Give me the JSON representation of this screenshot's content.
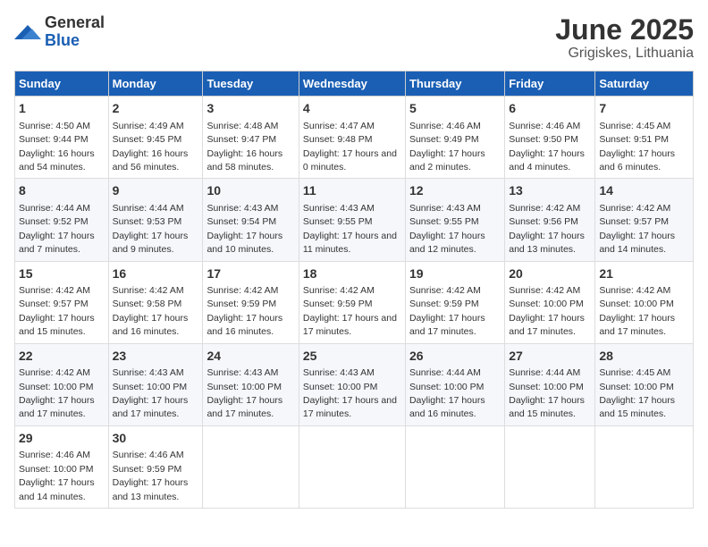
{
  "logo": {
    "general": "General",
    "blue": "Blue"
  },
  "title": "June 2025",
  "subtitle": "Grigiskes, Lithuania",
  "headers": [
    "Sunday",
    "Monday",
    "Tuesday",
    "Wednesday",
    "Thursday",
    "Friday",
    "Saturday"
  ],
  "weeks": [
    [
      {
        "day": "1",
        "sunrise": "4:50 AM",
        "sunset": "9:44 PM",
        "daylight": "16 hours and 54 minutes."
      },
      {
        "day": "2",
        "sunrise": "4:49 AM",
        "sunset": "9:45 PM",
        "daylight": "16 hours and 56 minutes."
      },
      {
        "day": "3",
        "sunrise": "4:48 AM",
        "sunset": "9:47 PM",
        "daylight": "16 hours and 58 minutes."
      },
      {
        "day": "4",
        "sunrise": "4:47 AM",
        "sunset": "9:48 PM",
        "daylight": "17 hours and 0 minutes."
      },
      {
        "day": "5",
        "sunrise": "4:46 AM",
        "sunset": "9:49 PM",
        "daylight": "17 hours and 2 minutes."
      },
      {
        "day": "6",
        "sunrise": "4:46 AM",
        "sunset": "9:50 PM",
        "daylight": "17 hours and 4 minutes."
      },
      {
        "day": "7",
        "sunrise": "4:45 AM",
        "sunset": "9:51 PM",
        "daylight": "17 hours and 6 minutes."
      }
    ],
    [
      {
        "day": "8",
        "sunrise": "4:44 AM",
        "sunset": "9:52 PM",
        "daylight": "17 hours and 7 minutes."
      },
      {
        "day": "9",
        "sunrise": "4:44 AM",
        "sunset": "9:53 PM",
        "daylight": "17 hours and 9 minutes."
      },
      {
        "day": "10",
        "sunrise": "4:43 AM",
        "sunset": "9:54 PM",
        "daylight": "17 hours and 10 minutes."
      },
      {
        "day": "11",
        "sunrise": "4:43 AM",
        "sunset": "9:55 PM",
        "daylight": "17 hours and 11 minutes."
      },
      {
        "day": "12",
        "sunrise": "4:43 AM",
        "sunset": "9:55 PM",
        "daylight": "17 hours and 12 minutes."
      },
      {
        "day": "13",
        "sunrise": "4:42 AM",
        "sunset": "9:56 PM",
        "daylight": "17 hours and 13 minutes."
      },
      {
        "day": "14",
        "sunrise": "4:42 AM",
        "sunset": "9:57 PM",
        "daylight": "17 hours and 14 minutes."
      }
    ],
    [
      {
        "day": "15",
        "sunrise": "4:42 AM",
        "sunset": "9:57 PM",
        "daylight": "17 hours and 15 minutes."
      },
      {
        "day": "16",
        "sunrise": "4:42 AM",
        "sunset": "9:58 PM",
        "daylight": "17 hours and 16 minutes."
      },
      {
        "day": "17",
        "sunrise": "4:42 AM",
        "sunset": "9:59 PM",
        "daylight": "17 hours and 16 minutes."
      },
      {
        "day": "18",
        "sunrise": "4:42 AM",
        "sunset": "9:59 PM",
        "daylight": "17 hours and 17 minutes."
      },
      {
        "day": "19",
        "sunrise": "4:42 AM",
        "sunset": "9:59 PM",
        "daylight": "17 hours and 17 minutes."
      },
      {
        "day": "20",
        "sunrise": "4:42 AM",
        "sunset": "10:00 PM",
        "daylight": "17 hours and 17 minutes."
      },
      {
        "day": "21",
        "sunrise": "4:42 AM",
        "sunset": "10:00 PM",
        "daylight": "17 hours and 17 minutes."
      }
    ],
    [
      {
        "day": "22",
        "sunrise": "4:42 AM",
        "sunset": "10:00 PM",
        "daylight": "17 hours and 17 minutes."
      },
      {
        "day": "23",
        "sunrise": "4:43 AM",
        "sunset": "10:00 PM",
        "daylight": "17 hours and 17 minutes."
      },
      {
        "day": "24",
        "sunrise": "4:43 AM",
        "sunset": "10:00 PM",
        "daylight": "17 hours and 17 minutes."
      },
      {
        "day": "25",
        "sunrise": "4:43 AM",
        "sunset": "10:00 PM",
        "daylight": "17 hours and 17 minutes."
      },
      {
        "day": "26",
        "sunrise": "4:44 AM",
        "sunset": "10:00 PM",
        "daylight": "17 hours and 16 minutes."
      },
      {
        "day": "27",
        "sunrise": "4:44 AM",
        "sunset": "10:00 PM",
        "daylight": "17 hours and 15 minutes."
      },
      {
        "day": "28",
        "sunrise": "4:45 AM",
        "sunset": "10:00 PM",
        "daylight": "17 hours and 15 minutes."
      }
    ],
    [
      {
        "day": "29",
        "sunrise": "4:46 AM",
        "sunset": "10:00 PM",
        "daylight": "17 hours and 14 minutes."
      },
      {
        "day": "30",
        "sunrise": "4:46 AM",
        "sunset": "9:59 PM",
        "daylight": "17 hours and 13 minutes."
      },
      null,
      null,
      null,
      null,
      null
    ]
  ]
}
